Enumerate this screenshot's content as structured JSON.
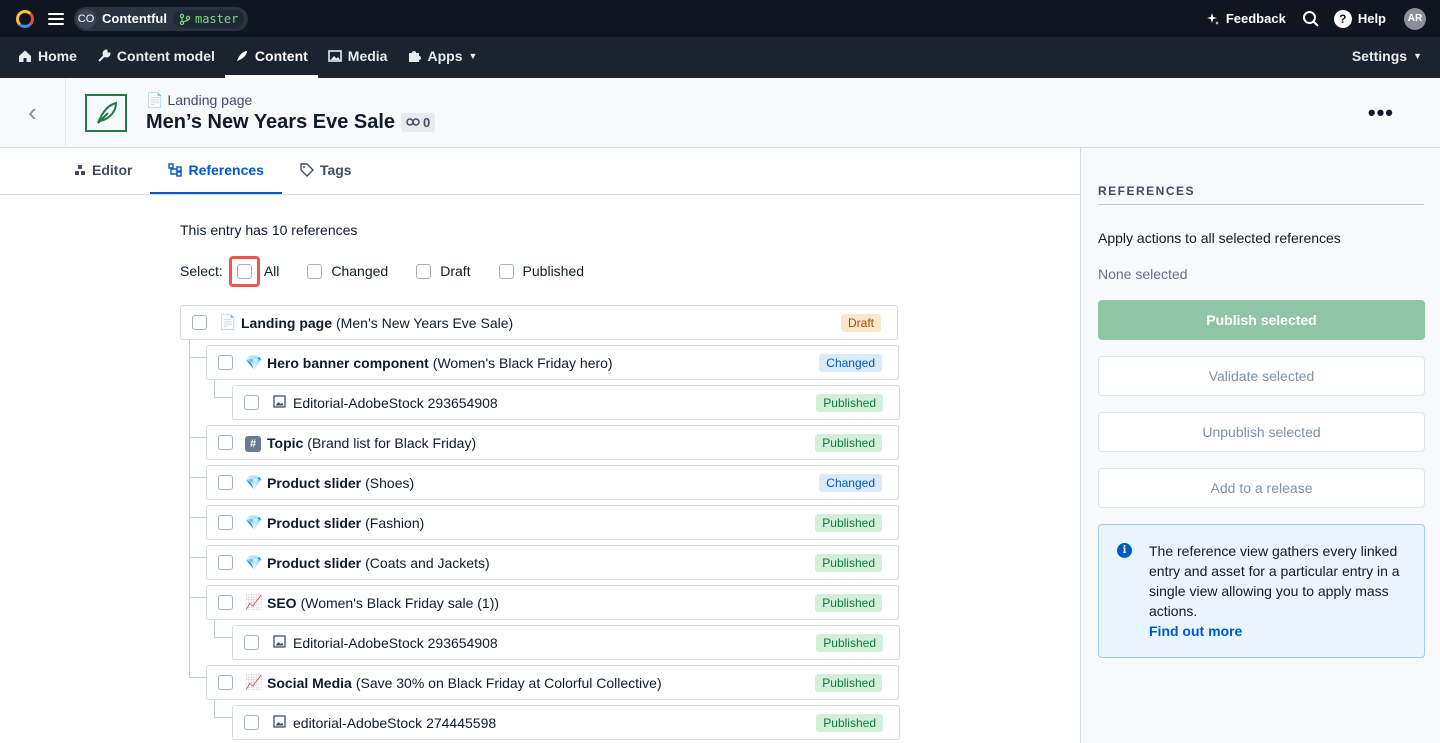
{
  "topbar": {
    "space_initials": "CO",
    "space_name": "Contentful",
    "environment": "master",
    "feedback": "Feedback",
    "help": "Help",
    "user_initials": "AR"
  },
  "nav": {
    "home": "Home",
    "content_model": "Content model",
    "content": "Content",
    "media": "Media",
    "apps": "Apps",
    "settings": "Settings"
  },
  "entry": {
    "content_type": "Landing page",
    "title": "Men’s New Years Eve Sale",
    "link_count": "0"
  },
  "tabs": {
    "editor": "Editor",
    "references": "References",
    "tags": "Tags"
  },
  "references": {
    "summary": "This entry has 10 references",
    "select_label": "Select:",
    "opt_all": "All",
    "opt_changed": "Changed",
    "opt_draft": "Draft",
    "opt_published": "Published",
    "items": [
      {
        "icon": "document-icon",
        "name": "Landing page",
        "detail": "(Men’s New Years Eve Sale)",
        "status": "Draft"
      },
      {
        "icon": "gem-icon",
        "name": "Hero banner component",
        "detail": "(Women's Black Friday hero)",
        "status": "Changed"
      },
      {
        "icon": "image-icon",
        "name": "",
        "detail": "Editorial-AdobeStock 293654908",
        "status": "Published"
      },
      {
        "icon": "hash-icon",
        "name": "Topic",
        "detail": "(Brand list for Black Friday)",
        "status": "Published"
      },
      {
        "icon": "gem-icon",
        "name": "Product slider",
        "detail": "(Shoes)",
        "status": "Changed"
      },
      {
        "icon": "gem-icon",
        "name": "Product slider",
        "detail": "(Fashion)",
        "status": "Published"
      },
      {
        "icon": "gem-icon",
        "name": "Product slider",
        "detail": "(Coats and Jackets)",
        "status": "Published"
      },
      {
        "icon": "chart-icon",
        "name": "SEO",
        "detail": "(Women's Black Friday sale (1))",
        "status": "Published"
      },
      {
        "icon": "image-icon",
        "name": "",
        "detail": "Editorial-AdobeStock 293654908",
        "status": "Published"
      },
      {
        "icon": "chart-icon",
        "name": "Social Media",
        "detail": "(Save 30% on Black Friday at Colorful Collective)",
        "status": "Published"
      },
      {
        "icon": "image-icon",
        "name": "",
        "detail": "editorial-AdobeStock 274445598",
        "status": "Published"
      }
    ]
  },
  "sidebar": {
    "heading": "REFERENCES",
    "description": "Apply actions to all selected references",
    "selection_state": "None selected",
    "publish": "Publish selected",
    "validate": "Validate selected",
    "unpublish": "Unpublish selected",
    "add_release": "Add to a release",
    "info_text": "The reference view gathers every linked entry and asset for a particular entry in a single view allowing you to apply mass actions.",
    "info_link": "Find out more"
  },
  "colors": {
    "topbar": "#0f1620",
    "navbar": "#1b232f",
    "accent": "#0059c8",
    "highlight": "#e9584a",
    "publish_button": "#8ec5a4"
  }
}
